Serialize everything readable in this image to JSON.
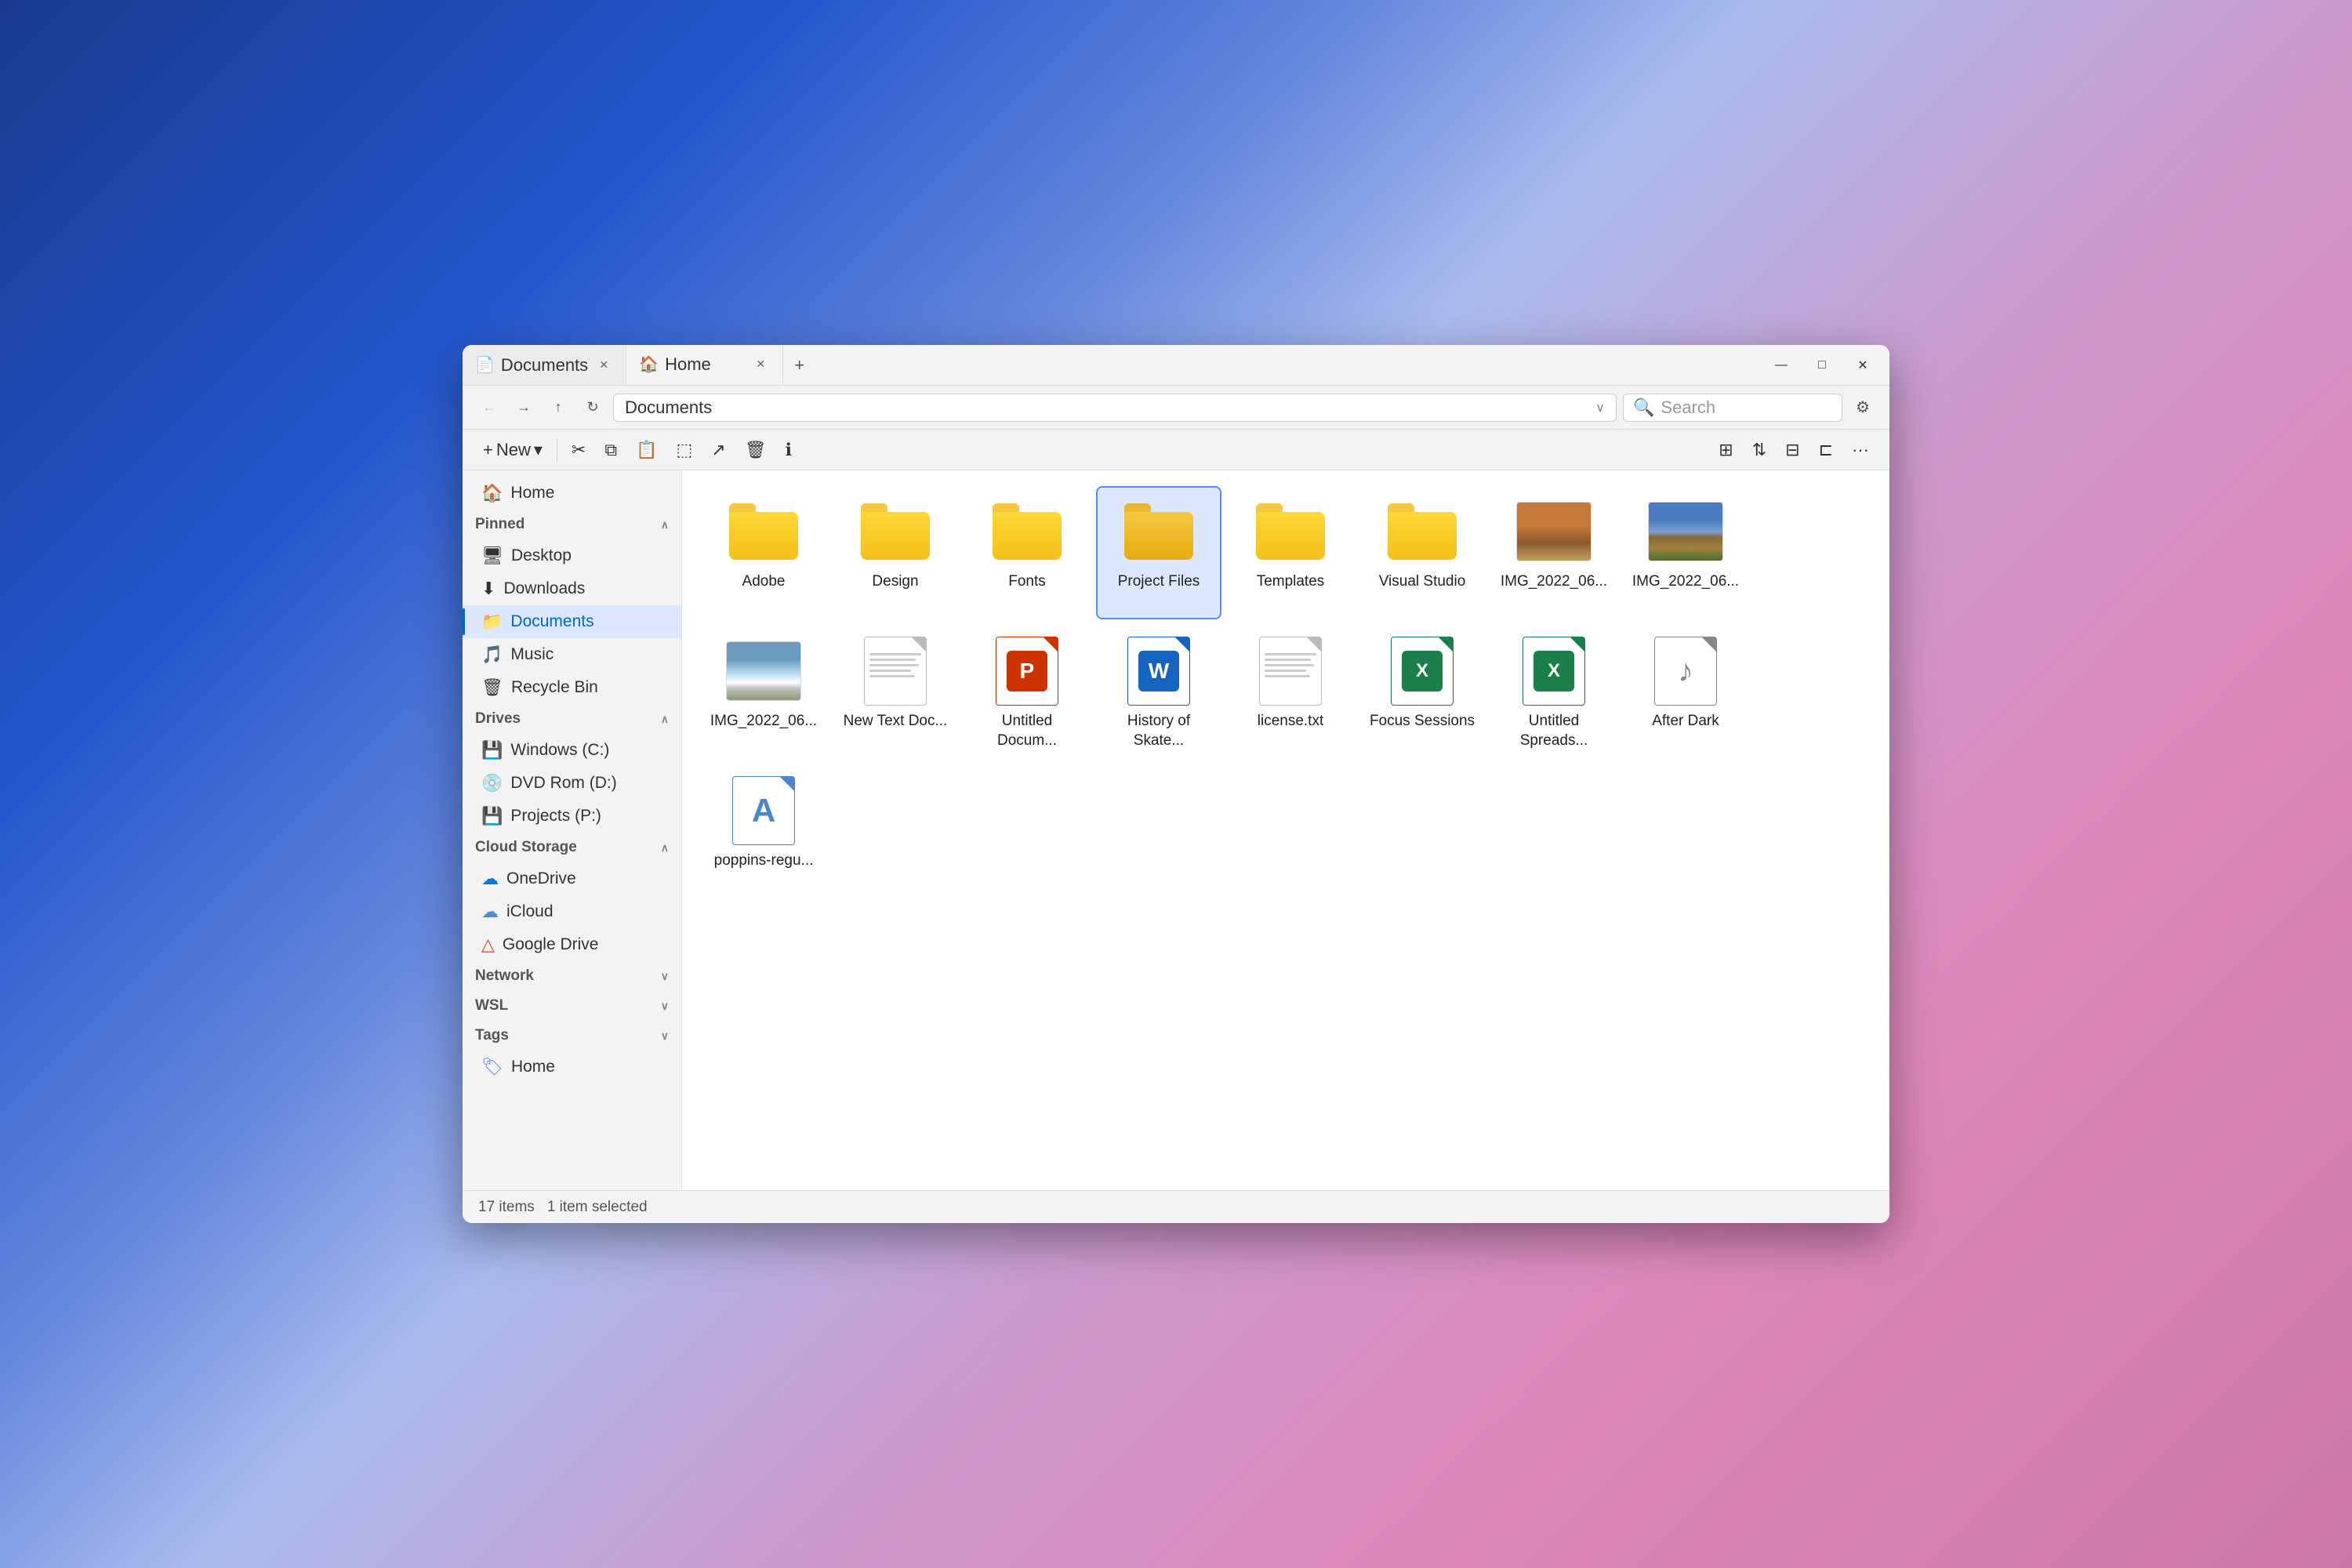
{
  "window": {
    "title": "Documents",
    "tabs": [
      {
        "id": "documents",
        "label": "Documents",
        "icon": "📄",
        "active": false
      },
      {
        "id": "home",
        "label": "Home",
        "icon": "🏠",
        "active": true
      }
    ],
    "add_tab_label": "+",
    "controls": {
      "minimize": "—",
      "maximize": "□",
      "close": "✕"
    }
  },
  "address_bar": {
    "back_label": "←",
    "forward_label": "→",
    "up_label": "↑",
    "refresh_label": "↻",
    "path": "Documents",
    "search_placeholder": "Search"
  },
  "toolbar": {
    "new_label": "New",
    "new_icon": "+",
    "new_chevron": "▾",
    "cut_icon": "✂",
    "copy_icon": "⧉",
    "paste_icon": "📋",
    "rename_icon": "⬚",
    "share_icon": "↗",
    "delete_icon": "🗑",
    "info_icon": "ℹ",
    "more_icon": "···"
  },
  "sidebar": {
    "sections": {
      "pinned": {
        "label": "Pinned",
        "collapsed": false
      },
      "drives": {
        "label": "Drives",
        "collapsed": false
      },
      "cloud": {
        "label": "Cloud Storage",
        "collapsed": false
      },
      "network": {
        "label": "Network",
        "collapsed": true
      },
      "wsl": {
        "label": "WSL",
        "collapsed": true
      },
      "tags": {
        "label": "Tags",
        "collapsed": true
      }
    },
    "pinned_items": [
      {
        "id": "home",
        "label": "Home",
        "icon": "🏠",
        "active": false
      },
      {
        "id": "desktop",
        "label": "Desktop",
        "icon": "🖥",
        "active": false
      },
      {
        "id": "downloads",
        "label": "Downloads",
        "icon": "⬇",
        "active": false
      },
      {
        "id": "documents",
        "label": "Documents",
        "icon": "📁",
        "active": true
      },
      {
        "id": "music",
        "label": "Music",
        "icon": "🎵",
        "active": false
      },
      {
        "id": "recycle",
        "label": "Recycle Bin",
        "icon": "🗑",
        "active": false
      }
    ],
    "drives": [
      {
        "id": "c",
        "label": "Windows (C:)",
        "icon": "💾"
      },
      {
        "id": "d",
        "label": "DVD Rom (D:)",
        "icon": "💿"
      },
      {
        "id": "p",
        "label": "Projects (P:)",
        "icon": "💾"
      }
    ],
    "cloud": [
      {
        "id": "onedrive",
        "label": "OneDrive",
        "icon": "☁"
      },
      {
        "id": "icloud",
        "label": "iCloud",
        "icon": "☁"
      },
      {
        "id": "googledrive",
        "label": "Google Drive",
        "icon": "△"
      }
    ],
    "tags": [
      {
        "id": "home-tag",
        "label": "Home",
        "icon": "🏷"
      }
    ]
  },
  "files": {
    "folders": [
      {
        "id": "adobe",
        "name": "Adobe",
        "selected": false
      },
      {
        "id": "design",
        "name": "Design",
        "selected": false
      },
      {
        "id": "fonts",
        "name": "Fonts",
        "selected": false
      },
      {
        "id": "project-files",
        "name": "Project Files",
        "selected": true
      },
      {
        "id": "templates",
        "name": "Templates",
        "selected": false
      },
      {
        "id": "visual-studio",
        "name": "Visual Studio",
        "selected": false
      }
    ],
    "files": [
      {
        "id": "img1",
        "name": "IMG_2022_06...",
        "type": "image",
        "subtype": "canyon"
      },
      {
        "id": "img2",
        "name": "IMG_2022_06...",
        "type": "image",
        "subtype": "mountain"
      },
      {
        "id": "img3",
        "name": "IMG_2022_06...",
        "type": "image",
        "subtype": "snow"
      },
      {
        "id": "new-text",
        "name": "New Text Doc...",
        "type": "text"
      },
      {
        "id": "untitled-doc",
        "name": "Untitled Docum...",
        "type": "ppt"
      },
      {
        "id": "history",
        "name": "History of Skate...",
        "type": "word"
      },
      {
        "id": "license",
        "name": "license.txt",
        "type": "text"
      },
      {
        "id": "focus-sessions",
        "name": "Focus Sessions",
        "type": "excel"
      },
      {
        "id": "untitled-spread",
        "name": "Untitled Spreads...",
        "type": "excel"
      },
      {
        "id": "after-dark",
        "name": "After Dark",
        "type": "music"
      },
      {
        "id": "poppins",
        "name": "poppins-regu...",
        "type": "font"
      }
    ]
  },
  "status_bar": {
    "item_count": "17 items",
    "selected_count": "1 item selected"
  }
}
